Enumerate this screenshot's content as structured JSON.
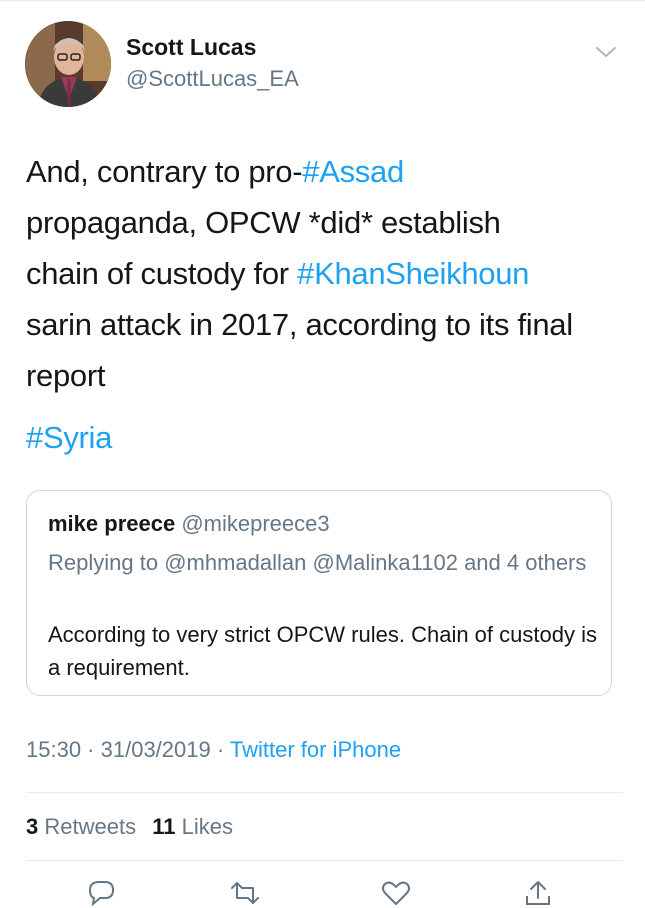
{
  "author": {
    "name": "Scott Lucas",
    "handle": "@ScottLucas_EA"
  },
  "tweet": {
    "line1_pre": "And, contrary to pro-",
    "line1_tag": "#Assad",
    "line2": "propaganda, OPCW *did* establish",
    "line3_pre": "chain of custody for ",
    "line3_tag": "#KhanSheikhoun",
    "line4": "sarin attack in 2017, according to its final",
    "line5": "report",
    "tag_syria": "#Syria"
  },
  "quoted": {
    "name": "mike preece",
    "handle": "@mikepreece3",
    "replying_prefix": "Replying to ",
    "mention1": "@mhmadallan",
    "mention2": "@Malinka1102",
    "replying_suffix": " and 4 others",
    "text": "According to very strict OPCW rules. Chain of custody is a requirement."
  },
  "meta": {
    "time": "15:30",
    "sep1": " · ",
    "date": "31/03/2019",
    "sep2": " · ",
    "source": "Twitter for iPhone"
  },
  "stats": {
    "retweets_count": "3",
    "retweets_label": "Retweets",
    "likes_count": "11",
    "likes_label": "Likes"
  },
  "icons": {
    "chevron": "chevron-down-icon",
    "reply": "reply-icon",
    "retweet": "retweet-icon",
    "like": "heart-icon",
    "share": "share-icon"
  },
  "colors": {
    "link": "#1da1f2",
    "muted": "#657786",
    "text": "#14171a",
    "border": "#ccd6dd"
  }
}
